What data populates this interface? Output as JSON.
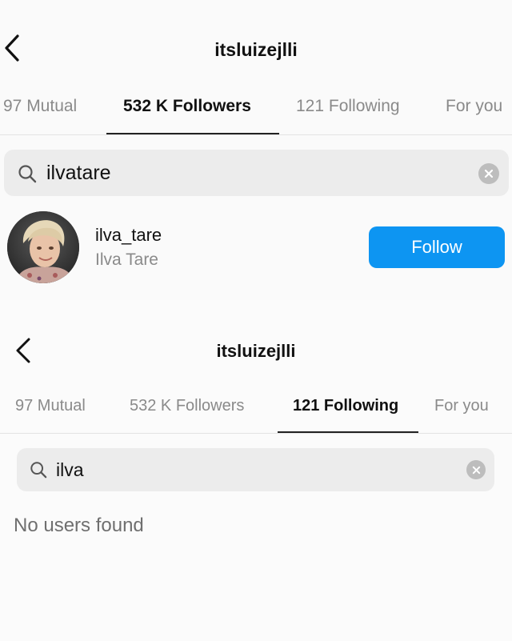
{
  "top": {
    "title": "itsluizejlli",
    "tabs": [
      "97 Mutual",
      "532 K Followers",
      "121 Following",
      "For you"
    ],
    "active_tab": "532 K Followers",
    "search": {
      "value": "ilvatare"
    },
    "result": {
      "username": "ilva_tare",
      "full_name": "Ilva Tare",
      "action_label": "Follow"
    }
  },
  "bottom": {
    "title": "itsluizejlli",
    "tabs": [
      "97 Mutual",
      "532 K Followers",
      "121 Following",
      "For you"
    ],
    "active_tab": "121 Following",
    "search": {
      "value": "ilva"
    },
    "empty_message": "No users found"
  },
  "colors": {
    "follow_button": "#0d95f2",
    "search_bg": "#ececec",
    "tab_inactive": "#8a8a8a"
  },
  "icons": [
    "chevron-left-icon",
    "search-icon",
    "clear-icon"
  ]
}
